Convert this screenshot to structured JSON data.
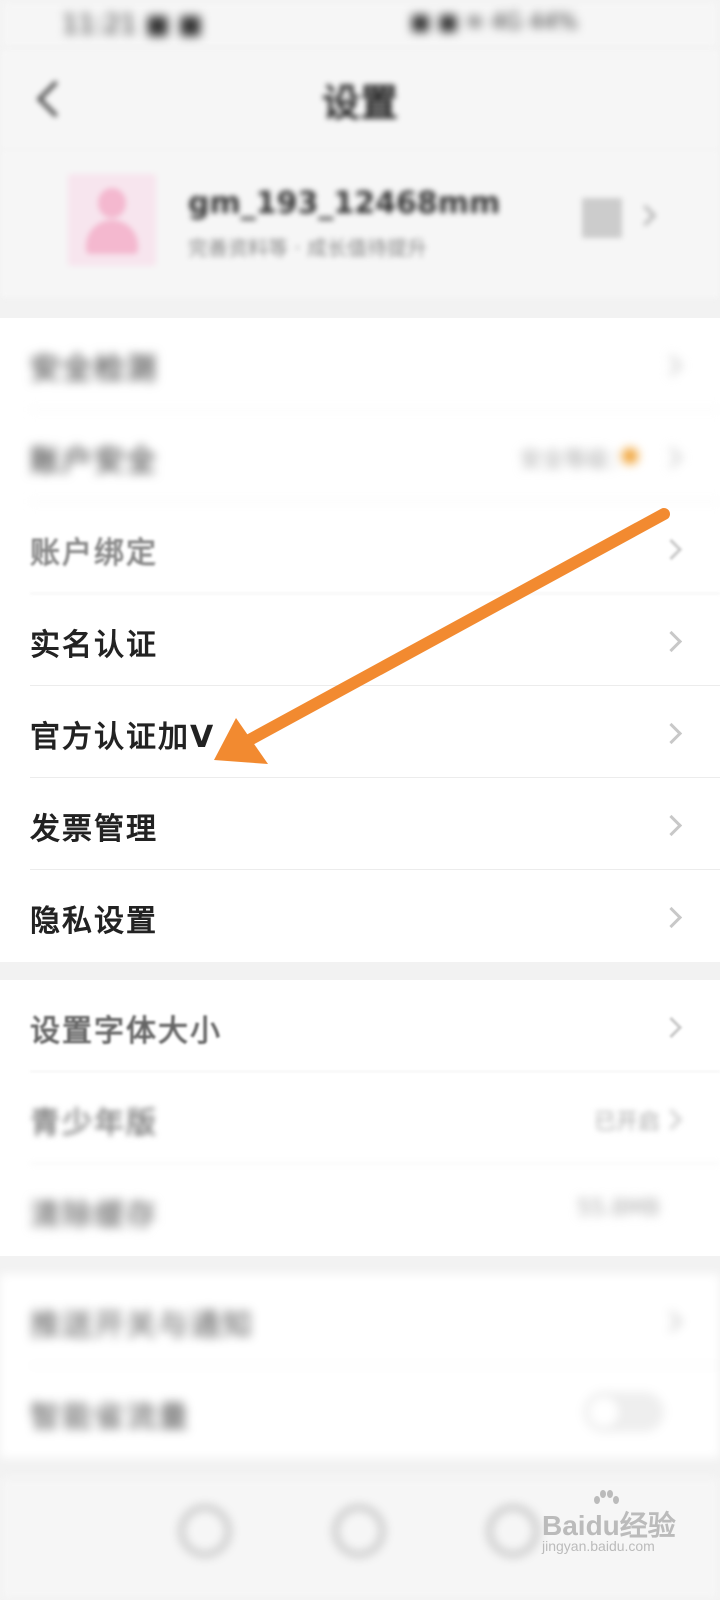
{
  "status_bar": {
    "left": "11:21 ■ ■",
    "right": "■ ■ ≋ 4G 44%"
  },
  "nav": {
    "title": "设置"
  },
  "profile": {
    "username": "gm_193_12468mm",
    "subtitle": "完善资料等 · 成长值待提升"
  },
  "sections": {
    "account": [
      {
        "label": "安全检测",
        "value": "",
        "dot": false
      },
      {
        "label": "账户安全",
        "value": "安全等级：",
        "dot": true
      },
      {
        "label": "账户绑定",
        "value": "",
        "dot": false
      },
      {
        "label": "实名认证",
        "value": "",
        "dot": false
      },
      {
        "label": "官方认证加V",
        "value": "",
        "dot": false
      },
      {
        "label": "发票管理",
        "value": "",
        "dot": false
      },
      {
        "label": "隐私设置",
        "value": "",
        "dot": false
      }
    ],
    "general": [
      {
        "label": "设置字体大小",
        "value": ""
      },
      {
        "label": "青少年版",
        "value": "已开启"
      },
      {
        "label": "清除缓存",
        "value": "55.8MB"
      }
    ],
    "other": [
      {
        "label": "推送开关与通知",
        "value": ""
      },
      {
        "label": "智能省流量",
        "toggle": false
      }
    ]
  },
  "watermark": {
    "brand": "Baidu经验",
    "sub": "jingyan.baidu.com"
  },
  "colors": {
    "annotation_arrow": "#f28a30",
    "background": "#f2f2f2",
    "row_background": "#ffffff"
  },
  "icons": [
    "back-icon",
    "chevron-right-icon",
    "qr-code-icon",
    "person-avatar-icon",
    "arrow-annotation-icon"
  ]
}
